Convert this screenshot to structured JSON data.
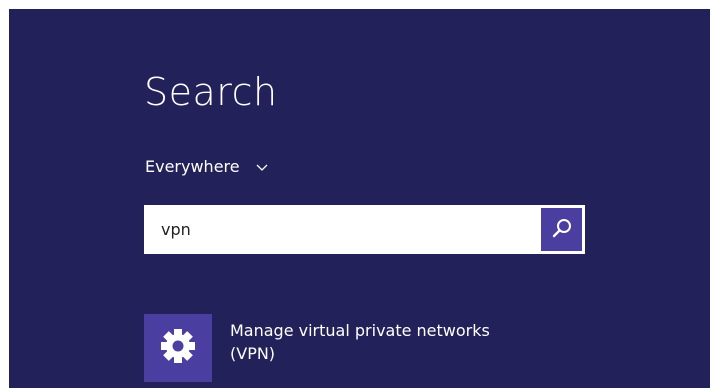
{
  "search_pane": {
    "title": "Search",
    "scope": {
      "label": "Everywhere",
      "icon": "chevron-down-icon"
    },
    "search_box": {
      "value": "vpn",
      "button_icon": "search-icon"
    },
    "results": [
      {
        "icon": "gear-icon",
        "label_line1": "Manage virtual private networks",
        "label_line2": "(VPN)"
      }
    ]
  },
  "colors": {
    "background": "#23215a",
    "accent": "#4a3fa0",
    "text": "#ffffff"
  }
}
